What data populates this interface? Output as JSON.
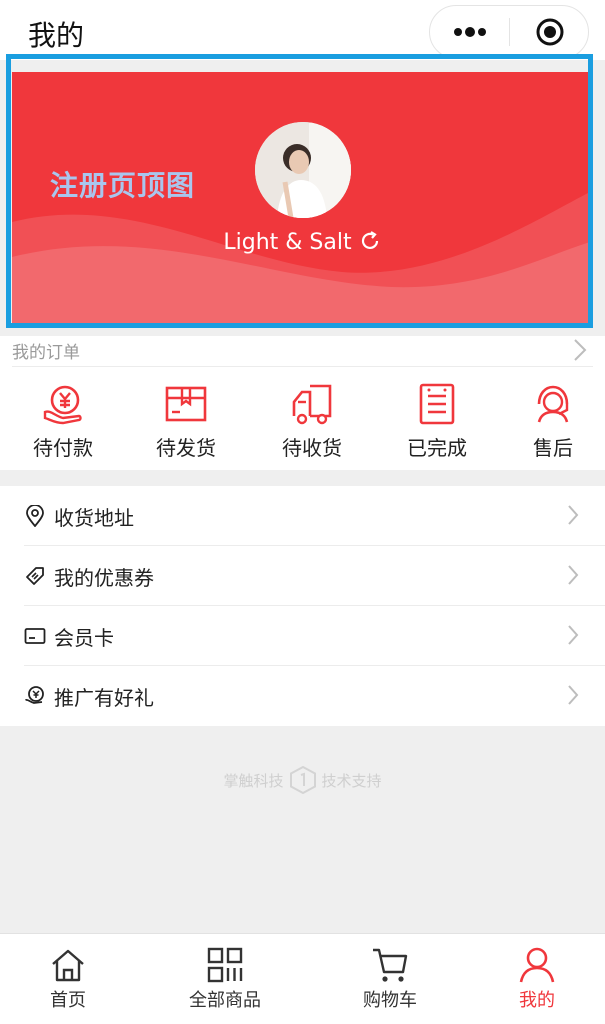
{
  "titlebar": {
    "title": "我的",
    "more_icon": "more-dots-icon",
    "close_icon": "record-close-icon"
  },
  "banner": {
    "overlay_text": "注册页顶图",
    "username": "Light & Salt",
    "refresh_icon": "refresh-icon",
    "avatar_icon": "user-avatar-photo",
    "background_color": "#f0373c",
    "frame_color": "#1a9ee0"
  },
  "orders": {
    "title": "我的订单",
    "items": [
      {
        "label": "待付款",
        "icon": "yen-hand-icon"
      },
      {
        "label": "待发货",
        "icon": "package-icon"
      },
      {
        "label": "待收货",
        "icon": "truck-icon"
      },
      {
        "label": "已完成",
        "icon": "receipt-icon"
      },
      {
        "label": "售后",
        "icon": "headset-icon"
      }
    ]
  },
  "menu": {
    "items": [
      {
        "label": "收货地址",
        "icon": "location-pin-icon"
      },
      {
        "label": "我的优惠券",
        "icon": "coupon-icon"
      },
      {
        "label": "会员卡",
        "icon": "card-icon"
      },
      {
        "label": "推广有好礼",
        "icon": "gift-coin-icon"
      }
    ]
  },
  "footer": {
    "brand": "掌触科技",
    "support_text": "技术支持",
    "logo_icon": "hexagon-logo-icon"
  },
  "tabbar": {
    "items": [
      {
        "label": "首页",
        "icon": "home-icon",
        "active": false
      },
      {
        "label": "全部商品",
        "icon": "grid-icon",
        "active": false
      },
      {
        "label": "购物车",
        "icon": "cart-icon",
        "active": false
      },
      {
        "label": "我的",
        "icon": "user-icon",
        "active": true
      }
    ]
  },
  "colors": {
    "accent": "#f0373c",
    "page_bg": "#efefef"
  }
}
